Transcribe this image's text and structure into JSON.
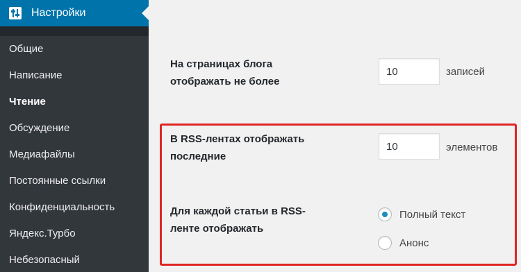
{
  "sidebar": {
    "section_title": "Настройки",
    "section_icon": "settings-sliders-icon",
    "items": [
      {
        "label": "Общие",
        "current": false
      },
      {
        "label": "Написание",
        "current": false
      },
      {
        "label": "Чтение",
        "current": true
      },
      {
        "label": "Обсуждение",
        "current": false
      },
      {
        "label": "Медиафайлы",
        "current": false
      },
      {
        "label": "Постоянные ссылки",
        "current": false
      },
      {
        "label": "Конфиденциальность",
        "current": false
      },
      {
        "label": "Яндекс.Турбо",
        "current": false
      },
      {
        "label": "Небезопасный",
        "current": false
      }
    ]
  },
  "settings": {
    "posts_per_page": {
      "label_line1": "На страницах блога",
      "label_line2": "отображать не более",
      "value": "10",
      "unit": "записей"
    },
    "rss_count": {
      "label_line1": "В RSS-лентах отображать",
      "label_line2": "последние",
      "value": "10",
      "unit": "элементов"
    },
    "rss_content": {
      "label_line1": "Для каждой статьи в RSS-",
      "label_line2": "ленте отображать",
      "options": [
        {
          "label": "Полный текст",
          "checked": true
        },
        {
          "label": "Анонс",
          "checked": false
        }
      ]
    }
  },
  "colors": {
    "sidebar_bg": "#23282d",
    "active_menu": "#0073aa",
    "highlight_border": "#e02424",
    "radio_checked": "#1e8cbe"
  }
}
